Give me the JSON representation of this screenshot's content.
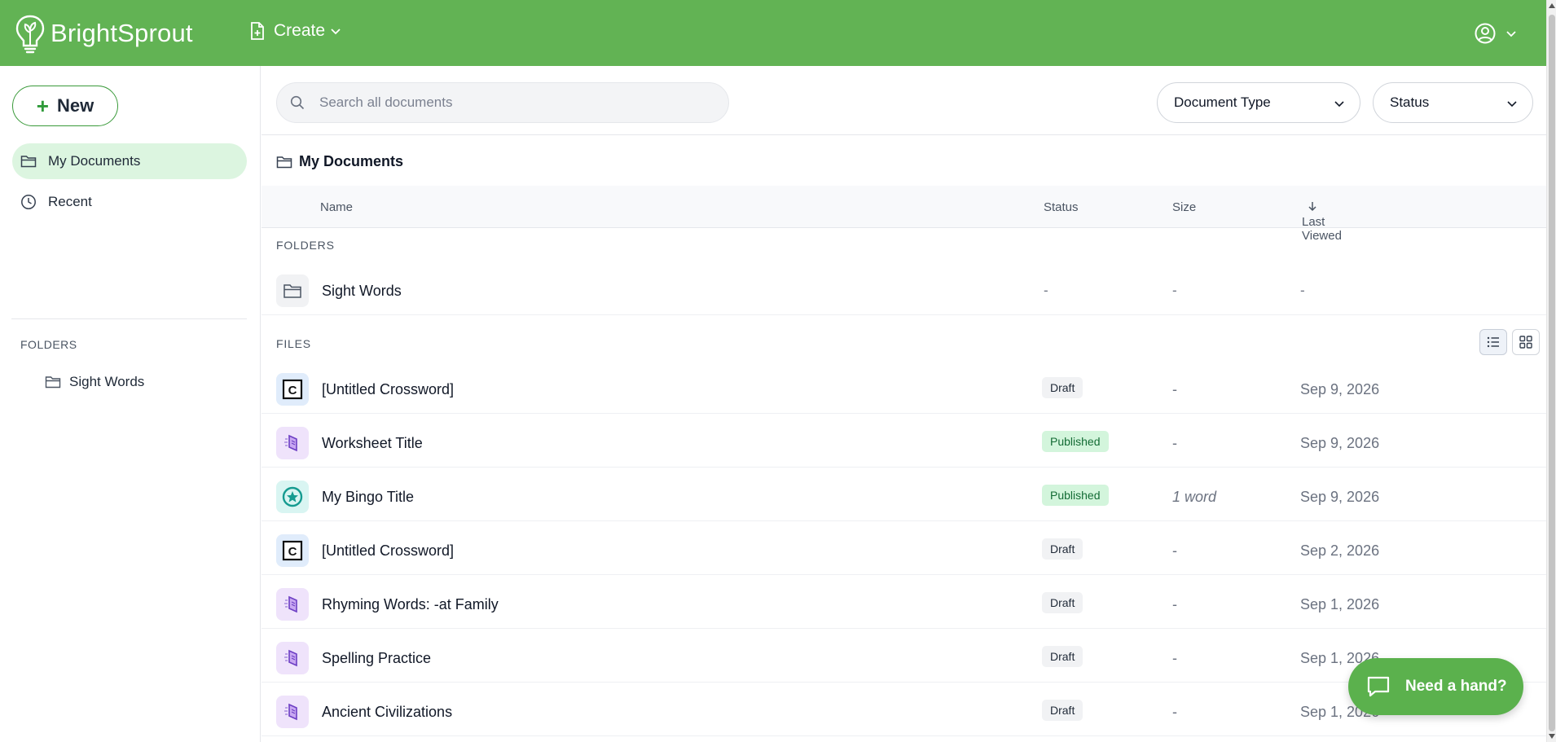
{
  "brand": {
    "name": "BrightSprout"
  },
  "header": {
    "create_label": "Create"
  },
  "sidebar": {
    "new_label": "New",
    "items": [
      {
        "label": "My Documents",
        "icon": "folder-icon",
        "active": true
      },
      {
        "label": "Recent",
        "icon": "clock-icon",
        "active": false
      }
    ],
    "folders_label": "FOLDERS",
    "folders": [
      {
        "label": "Sight Words"
      }
    ]
  },
  "search": {
    "placeholder": "Search all documents",
    "value": ""
  },
  "filters": {
    "document_type": "Document Type",
    "status": "Status"
  },
  "breadcrumb": {
    "title": "My Documents"
  },
  "table": {
    "headers": {
      "name": "Name",
      "status": "Status",
      "size": "Size",
      "last_viewed": "Last Viewed"
    },
    "folders_label": "FOLDERS",
    "files_label": "FILES",
    "folder_rows": [
      {
        "name": "Sight Words",
        "status": "-",
        "size": "-",
        "last_viewed": "-"
      }
    ],
    "file_rows": [
      {
        "name": "[Untitled Crossword]",
        "type": "crossword",
        "status": "Draft",
        "size": "-",
        "last_viewed": "Sep 9, 2026"
      },
      {
        "name": "Worksheet Title",
        "type": "worksheet",
        "status": "Published",
        "size": "-",
        "last_viewed": "Sep 9, 2026"
      },
      {
        "name": "My Bingo Title",
        "type": "bingo",
        "status": "Published",
        "size": "1 word",
        "last_viewed": "Sep 9, 2026"
      },
      {
        "name": "[Untitled Crossword]",
        "type": "crossword",
        "status": "Draft",
        "size": "-",
        "last_viewed": "Sep 2, 2026"
      },
      {
        "name": "Rhyming Words: -at Family",
        "type": "worksheet",
        "status": "Draft",
        "size": "-",
        "last_viewed": "Sep 1, 2026"
      },
      {
        "name": "Spelling Practice",
        "type": "worksheet",
        "status": "Draft",
        "size": "-",
        "last_viewed": "Sep 1, 2026"
      },
      {
        "name": "Ancient Civilizations",
        "type": "worksheet",
        "status": "Draft",
        "size": "-",
        "last_viewed": "Sep 1, 2026"
      }
    ]
  },
  "help": {
    "label": "Need a hand?"
  },
  "colors": {
    "brand_green": "#62b354",
    "active_bg": "#dcf5e0",
    "published_bg": "#d3f5dc",
    "published_text": "#146c35"
  }
}
